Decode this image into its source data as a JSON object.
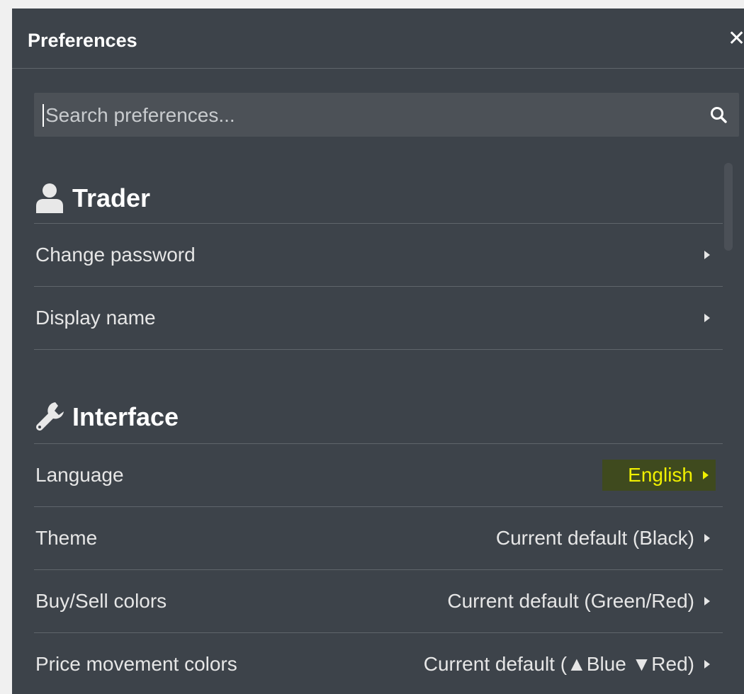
{
  "window": {
    "title": "Preferences",
    "close_glyph": "✕"
  },
  "search": {
    "placeholder": "Search preferences...",
    "value": ""
  },
  "sections": [
    {
      "title": "Trader",
      "icon": "user-icon",
      "items": [
        {
          "label": "Change password",
          "value": ""
        },
        {
          "label": "Display name",
          "value": ""
        }
      ]
    },
    {
      "title": "Interface",
      "icon": "wrench-icon",
      "items": [
        {
          "label": "Language",
          "value": "English"
        },
        {
          "label": "Theme",
          "value": "Current default (Black)"
        },
        {
          "label": "Buy/Sell colors",
          "value": "Current default (Green/Red)"
        },
        {
          "label": "Price movement colors",
          "value": "Current default (▲Blue ▼Red)"
        }
      ]
    }
  ],
  "colors": {
    "panel_bg": "#3d434a",
    "divider": "#5f656b",
    "highlight_text": "#f0f000",
    "highlight_bg": "#3f4a1e"
  }
}
